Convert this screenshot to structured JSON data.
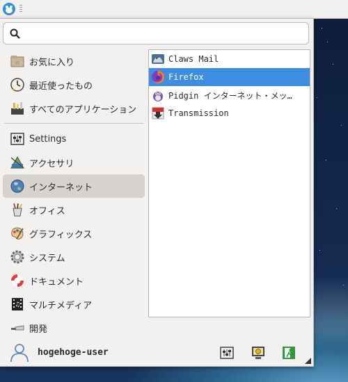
{
  "search": {
    "value": "",
    "placeholder": ""
  },
  "categories": [
    {
      "label": "お気に入り",
      "icon": "favorites-icon"
    },
    {
      "label": "最近使ったもの",
      "icon": "recent-clock-icon"
    },
    {
      "label": "すべてのアプリケーション",
      "icon": "all-applications-icon"
    },
    {
      "label": "Settings",
      "icon": "settings-icon"
    },
    {
      "label": "アクセサリ",
      "icon": "accessories-icon"
    },
    {
      "label": "インターネット",
      "icon": "internet-globe-icon",
      "selected": true
    },
    {
      "label": "オフィス",
      "icon": "office-icon"
    },
    {
      "label": "グラフィックス",
      "icon": "graphics-palette-icon"
    },
    {
      "label": "システム",
      "icon": "system-gear-icon"
    },
    {
      "label": "ドキュメント",
      "icon": "documentation-lifebuoy-icon"
    },
    {
      "label": "マルチメディア",
      "icon": "multimedia-film-icon"
    },
    {
      "label": "開発",
      "icon": "development-trowel-icon"
    }
  ],
  "apps": [
    {
      "label": "Claws Mail",
      "icon": "claws-mail-icon"
    },
    {
      "label": "Firefox",
      "icon": "firefox-icon",
      "selected": true
    },
    {
      "label": "Pidgin インターネット・メッ…",
      "icon": "pidgin-icon"
    },
    {
      "label": "Transmission",
      "icon": "transmission-icon"
    }
  ],
  "footer": {
    "username": "hogehoge-user",
    "buttons": [
      "settings-manager-icon",
      "lock-screen-icon",
      "log-out-icon"
    ]
  },
  "colors": {
    "selection": "#3d8ee0",
    "category_selected": "#d6d3cf"
  }
}
